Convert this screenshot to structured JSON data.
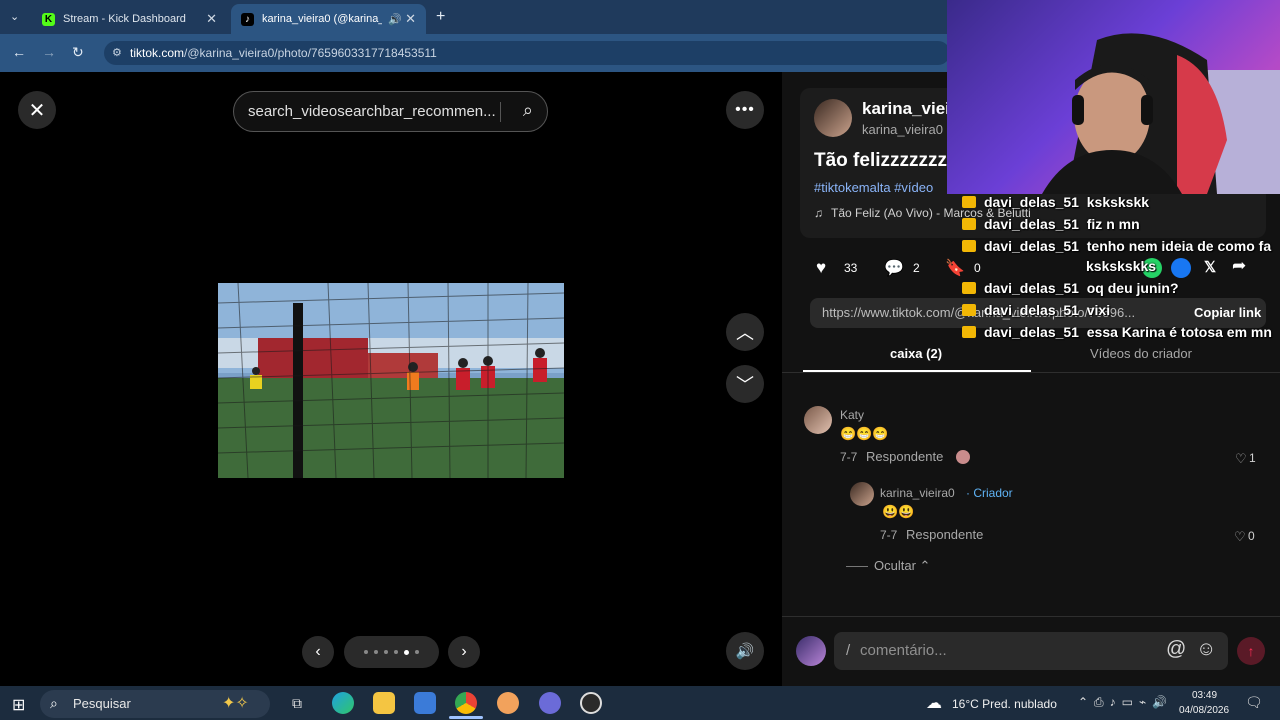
{
  "browser": {
    "tabs": [
      {
        "title": "Stream - Kick Dashboard",
        "active": false
      },
      {
        "title": "karina_vieira0 (@karina_vieir",
        "active": true
      }
    ],
    "url": "tiktok.com/@karina_vieira0/photo/7659603317718453511",
    "url_prefix": "tiktok.com",
    "url_rest": "/@karina_vieira0/photo/7659603317718453511"
  },
  "viewer": {
    "search_placeholder": "search_videosearchbar_recommen...",
    "close_icon": "close-icon",
    "more_icon": "more-icon"
  },
  "post": {
    "username": "karina_vieira0",
    "username_display": "karina_vieir",
    "handle": "karina_vieira0",
    "title": "Tão felizzzzzzz",
    "hashtags": "#tiktokemalta #vídeo",
    "music": "Tão Feliz (Ao Vivo) - Marcos & Belutti",
    "likes": "33",
    "comments": "2",
    "saves": "0",
    "share_url": "https://www.tiktok.com/@karina_vieira0/photo/76596...",
    "copy_link": "Copiar link"
  },
  "tabs": [
    {
      "label": "caixa (2)",
      "active": true
    },
    {
      "label": "Vídeos do criador",
      "active": false
    }
  ],
  "comments": [
    {
      "author": "Katy",
      "text": "😁😁😁",
      "date": "7-7",
      "reply": "Respondente",
      "likes": "1"
    }
  ],
  "reply": {
    "author": "karina_vieira0",
    "badge": "· Criador",
    "text": "😃😃",
    "date": "7-7",
    "reply": "Respondente",
    "likes": "0"
  },
  "hide_label": "Ocultar",
  "comment_placeholder": "comentário...",
  "chat": [
    {
      "user": "davi_delas_51",
      "msg": "kskskskk"
    },
    {
      "user": "davi_delas_51",
      "msg": "fiz n mn"
    },
    {
      "user": "davi_delas_51",
      "msg": "tenho nem ideia de como fa"
    },
    {
      "user": "davi_delas_51",
      "msg": "kskskskks"
    },
    {
      "user": "davi_delas_51",
      "msg": "oq deu junin?"
    },
    {
      "user": "davi_delas_51",
      "msg": "vixi"
    },
    {
      "user": "davi_delas_51",
      "msg": "essa Karina é totosa em mn"
    }
  ],
  "taskbar": {
    "search": "Pesquisar",
    "weather": "16°C  Pred. nublado",
    "time": "03:49",
    "date": "04/08/2026"
  },
  "colors": {
    "accent": "#fe2c55",
    "link": "#8ab4f8",
    "creator": "#5fb3f5"
  }
}
